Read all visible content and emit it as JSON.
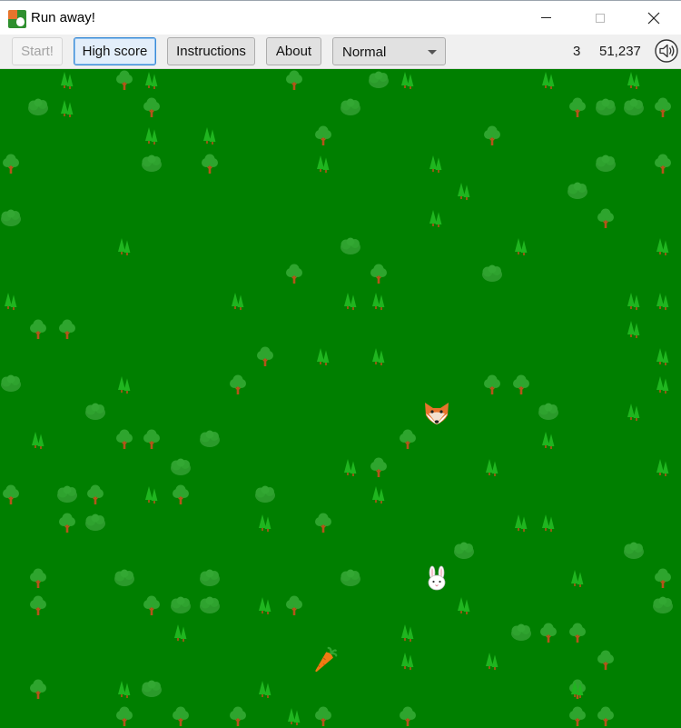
{
  "window": {
    "title": "Run away!",
    "icon": "fox-and-bunny-app-icon",
    "controls": [
      "minimize-icon",
      "maximize-icon",
      "close-icon"
    ]
  },
  "toolbar": {
    "start_label": "Start!",
    "start_enabled": false,
    "high_score_label": "High score",
    "instructions_label": "Instructions",
    "about_label": "About",
    "difficulty": {
      "selected": "Normal"
    },
    "lives": "3",
    "score": "51,237",
    "sound_icon": "speaker-icon"
  },
  "game": {
    "background_color": "#007f00",
    "colors": {
      "tree_foliage": "#2ea52e",
      "tree_trunk": "#b5541a",
      "pine": "#1fb51f",
      "bush": "#2b9a2b",
      "fox": "#e8742c",
      "bunny": "#ffffff",
      "carrot": "#f07a12"
    },
    "characters": [
      {
        "type": "fox",
        "icon": "fox-icon"
      },
      {
        "type": "bunny",
        "icon": "bunny-icon"
      },
      {
        "type": "carrot",
        "icon": "carrot-icon"
      }
    ]
  }
}
